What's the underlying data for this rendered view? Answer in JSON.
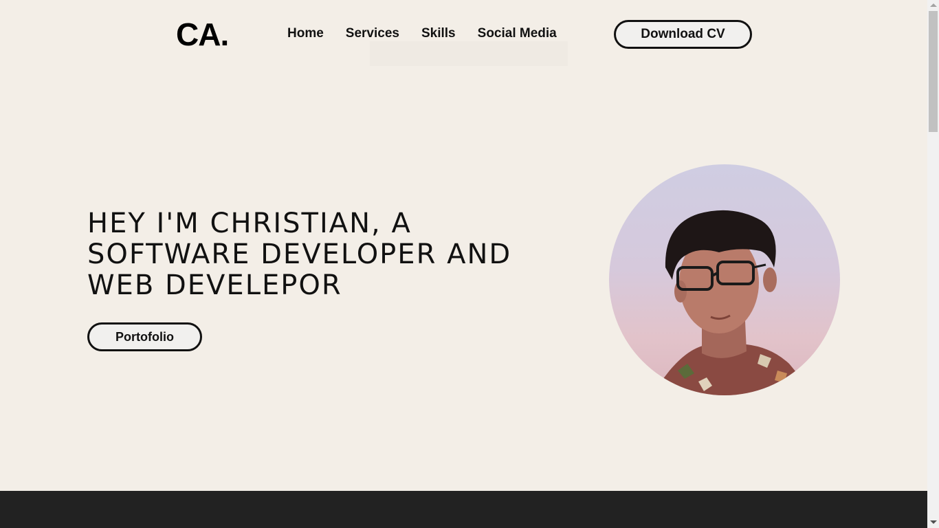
{
  "header": {
    "logo": "CA.",
    "nav": [
      {
        "label": "Home"
      },
      {
        "label": "Services"
      },
      {
        "label": "Skills"
      },
      {
        "label": "Social Media"
      }
    ],
    "cv_button": "Download CV"
  },
  "hero": {
    "title": "HEY I'M CHRISTIAN, A SOFTWARE DEVELOPER AND WEB DEVELEPOR",
    "portfolio_button": "Portofolio"
  },
  "colors": {
    "background": "#f3eee7",
    "footer": "#222222",
    "text": "#111111"
  }
}
